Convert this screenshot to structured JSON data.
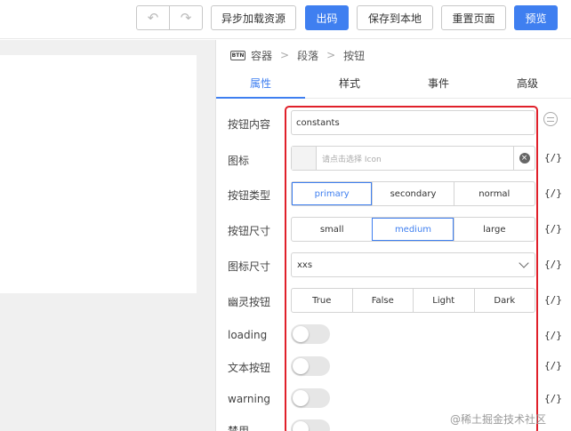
{
  "toolbar": {
    "undo_icon": "undo-icon",
    "redo_icon": "redo-icon",
    "async_load_label": "异步加载资源",
    "export_code_label": "出码",
    "save_local_label": "保存到本地",
    "reset_page_label": "重置页面",
    "preview_label": "预览"
  },
  "breadcrumb": {
    "icon_text": "BTN",
    "items": [
      "容器",
      "段落",
      "按钮"
    ],
    "separator": ">"
  },
  "tabs": [
    "属性",
    "样式",
    "事件",
    "高级"
  ],
  "props": {
    "content": {
      "label": "按钮内容",
      "value": "constants"
    },
    "icon": {
      "label": "图标",
      "placeholder": "请点击选择 Icon"
    },
    "type": {
      "label": "按钮类型",
      "options": [
        "primary",
        "secondary",
        "normal"
      ],
      "selected": "primary"
    },
    "size": {
      "label": "按钮尺寸",
      "options": [
        "small",
        "medium",
        "large"
      ],
      "selected": "medium"
    },
    "icon_size": {
      "label": "图标尺寸",
      "value": "xxs"
    },
    "ghost": {
      "label": "幽灵按钮",
      "options": [
        "True",
        "False",
        "Light",
        "Dark"
      ]
    },
    "loading": {
      "label": "loading",
      "on": false
    },
    "text_button": {
      "label": "文本按钮",
      "on": false
    },
    "warning": {
      "label": "warning",
      "on": false
    },
    "disabled": {
      "label": "禁用",
      "on": false
    }
  },
  "code_toggle": "{/}",
  "accent_color": "#3f7ff0",
  "highlight_color": "#e0202a",
  "watermark": "@稀土掘金技术社区"
}
